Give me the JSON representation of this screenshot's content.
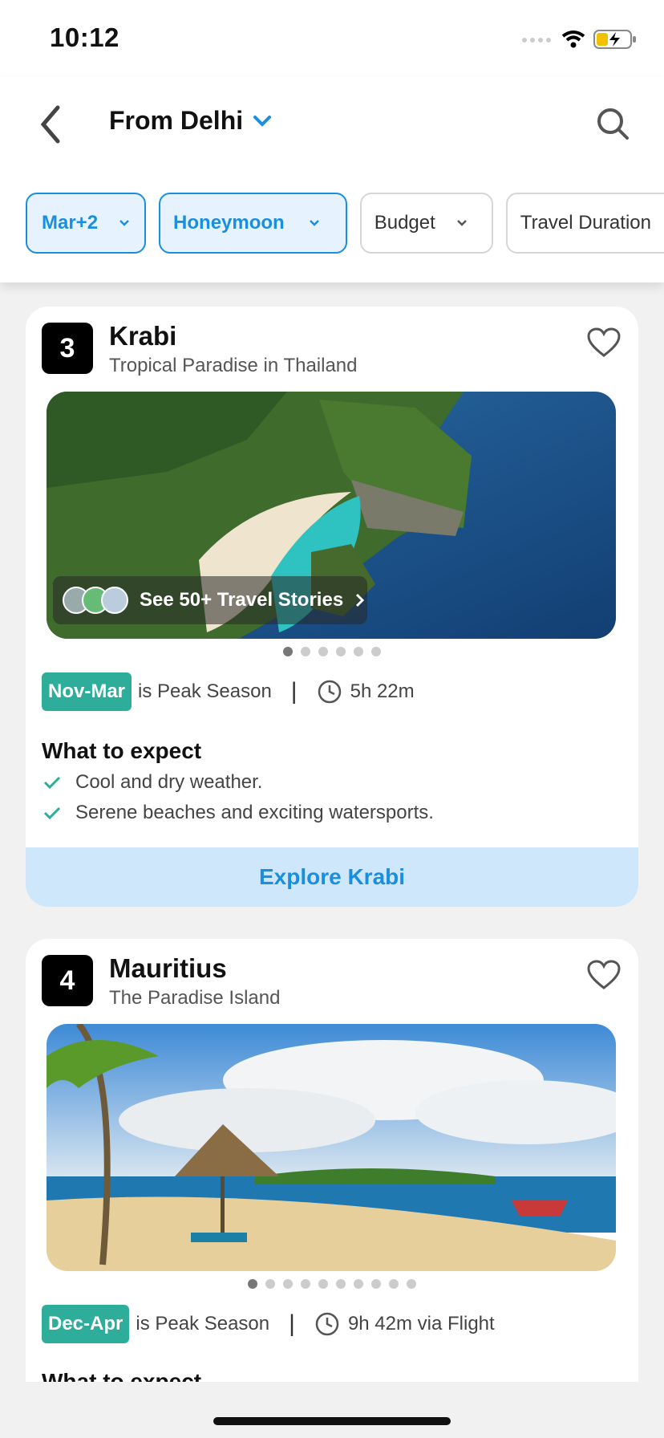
{
  "status": {
    "time": "10:12"
  },
  "header": {
    "title": "From Delhi",
    "filters": [
      {
        "label": "Mar+2",
        "active": true
      },
      {
        "label": "Honeymoon",
        "active": true
      },
      {
        "label": "Budget",
        "active": false
      },
      {
        "label": "Travel Duration",
        "active": false
      }
    ]
  },
  "cards": [
    {
      "rank": "3",
      "name": "Krabi",
      "tagline": "Tropical Paradise in Thailand",
      "stories_label": "See 50+ Travel Stories",
      "season": "Nov-Mar",
      "season_suffix": "is Peak Season",
      "separator": "|",
      "duration": "5h 22m",
      "expect_title": "What to expect",
      "expect": [
        "Cool and dry weather.",
        "Serene beaches and exciting watersports."
      ],
      "explore_label": "Explore Krabi",
      "image_dots": 6
    },
    {
      "rank": "4",
      "name": "Mauritius",
      "tagline": "The Paradise Island",
      "season": "Dec-Apr",
      "season_suffix": "is Peak Season",
      "separator": "|",
      "duration": "9h 42m via Flight",
      "expect_title": "What to expect",
      "image_dots": 10
    }
  ],
  "colors": {
    "accent": "#1a8fe0",
    "season": "#2eae9a",
    "button_bg": "#cfe7fb"
  }
}
